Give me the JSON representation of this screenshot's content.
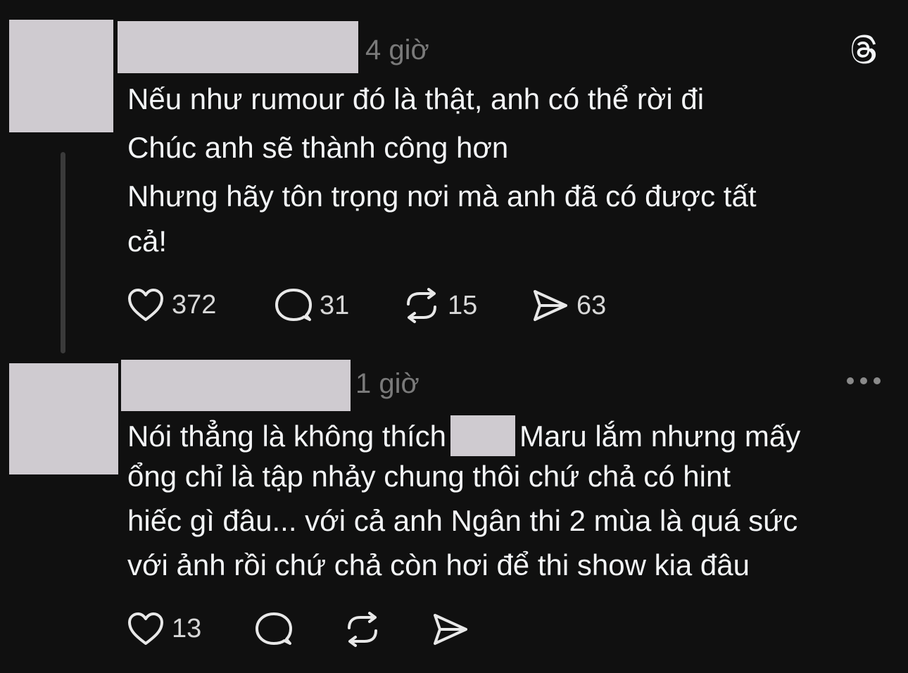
{
  "post1": {
    "time": "4 giờ",
    "lines": [
      "Nếu như rumour đó là thật, anh có thể rời đi",
      "Chúc anh sẽ thành công hơn",
      "Nhưng hãy tôn trọng nơi mà anh đã có được tất",
      "cả!"
    ],
    "actions": {
      "likes": "372",
      "comments": "31",
      "reposts": "15",
      "shares": "63"
    }
  },
  "post2": {
    "time": "1 giờ",
    "line1_before": "Nói thẳng là không thích",
    "line1_after": "Maru lắm nhưng mấy",
    "lines": [
      "ổng chỉ là tập nhảy chung thôi chứ chả có hint",
      "hiếc gì đâu... với cả anh Ngân thi 2 mùa là quá sức",
      "với ảnh rồi chứ chả còn hơi để thi show kia đâu"
    ],
    "actions": {
      "likes": "13"
    }
  },
  "icons": {
    "app_logo": "threads-logo-icon",
    "more": "more-options-icon",
    "like": "heart-icon",
    "comment": "comment-bubble-icon",
    "repost": "repost-icon",
    "share": "send-icon"
  },
  "colors": {
    "background": "#101010",
    "text": "#f3f5f7",
    "muted": "#7a7a7a",
    "redaction": "#cfcbd0"
  }
}
